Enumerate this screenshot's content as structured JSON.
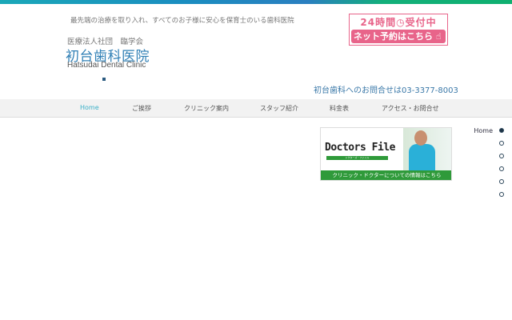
{
  "header": {
    "tagline": "最先端の治療を取り入れ、すべてのお子様に安心を保育士のいる歯科医院",
    "corporation": "医療法人社団　臨学会",
    "clinic_name": "初台歯科医院",
    "clinic_name_en": "Hatsudai Dental Clinic",
    "reservation_line1": "24時間◷受付中",
    "reservation_line2": "ネット予約はこちら",
    "phone_text": "初台歯科へのお問合せは03-3377-8003"
  },
  "nav": {
    "items": [
      {
        "label": "Home",
        "active": true
      },
      {
        "label": "ご挨拶"
      },
      {
        "label": "クリニック案内"
      },
      {
        "label": "スタッフ紹介"
      },
      {
        "label": "料金表"
      },
      {
        "label": "アクセス・お問合せ"
      }
    ]
  },
  "banner": {
    "title": "Doctors File",
    "subtitle": "ドクターズ・ファイル",
    "caption": "クリニック・ドクターについての情報はこちら"
  },
  "side_nav": {
    "items": [
      {
        "label": "Home",
        "active": true
      },
      {
        "label": ""
      },
      {
        "label": ""
      },
      {
        "label": ""
      },
      {
        "label": ""
      },
      {
        "label": ""
      }
    ]
  },
  "colors": {
    "accent": "#2f7fb5",
    "pink": "#e8648a",
    "green": "#2f9a3a"
  }
}
